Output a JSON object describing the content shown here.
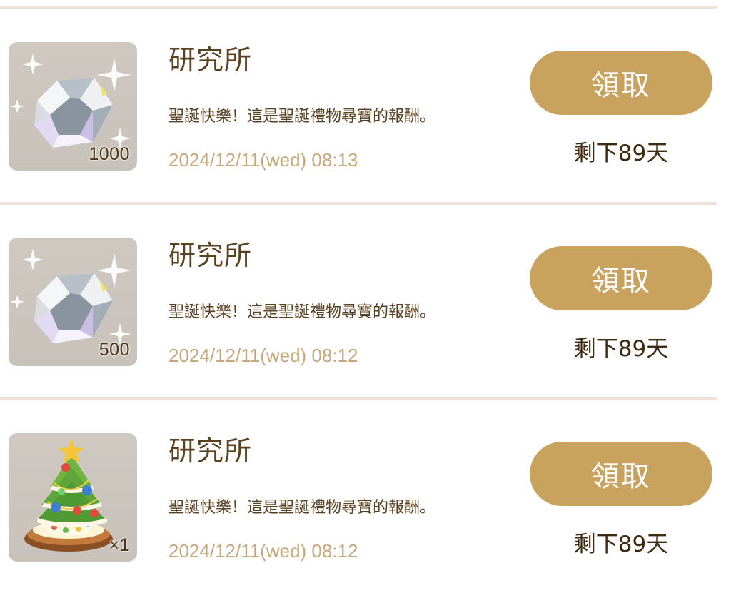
{
  "items": [
    {
      "icon": "diamond-icon",
      "quantity": "1000",
      "title": "研究所",
      "message": "聖誕快樂！這是聖誕禮物尋寶的報酬。",
      "date": "2024/12/11(wed) 08:13",
      "claim_label": "領取",
      "remaining": "剩下89天"
    },
    {
      "icon": "diamond-icon",
      "quantity": "500",
      "title": "研究所",
      "message": "聖誕快樂！這是聖誕禮物尋寶的報酬。",
      "date": "2024/12/11(wed) 08:12",
      "claim_label": "領取",
      "remaining": "剩下89天"
    },
    {
      "icon": "christmas-tree-icon",
      "quantity": "×1",
      "title": "研究所",
      "message": "聖誕快樂！這是聖誕禮物尋寶的報酬。",
      "date": "2024/12/11(wed) 08:12",
      "claim_label": "領取",
      "remaining": "剩下89天"
    }
  ],
  "colors": {
    "accent": "#c9a25d",
    "title_text": "#5a4221",
    "date_text": "#c7a87b",
    "divider": "#f0e2d6",
    "thumb_bg": "#cfc8c1"
  }
}
